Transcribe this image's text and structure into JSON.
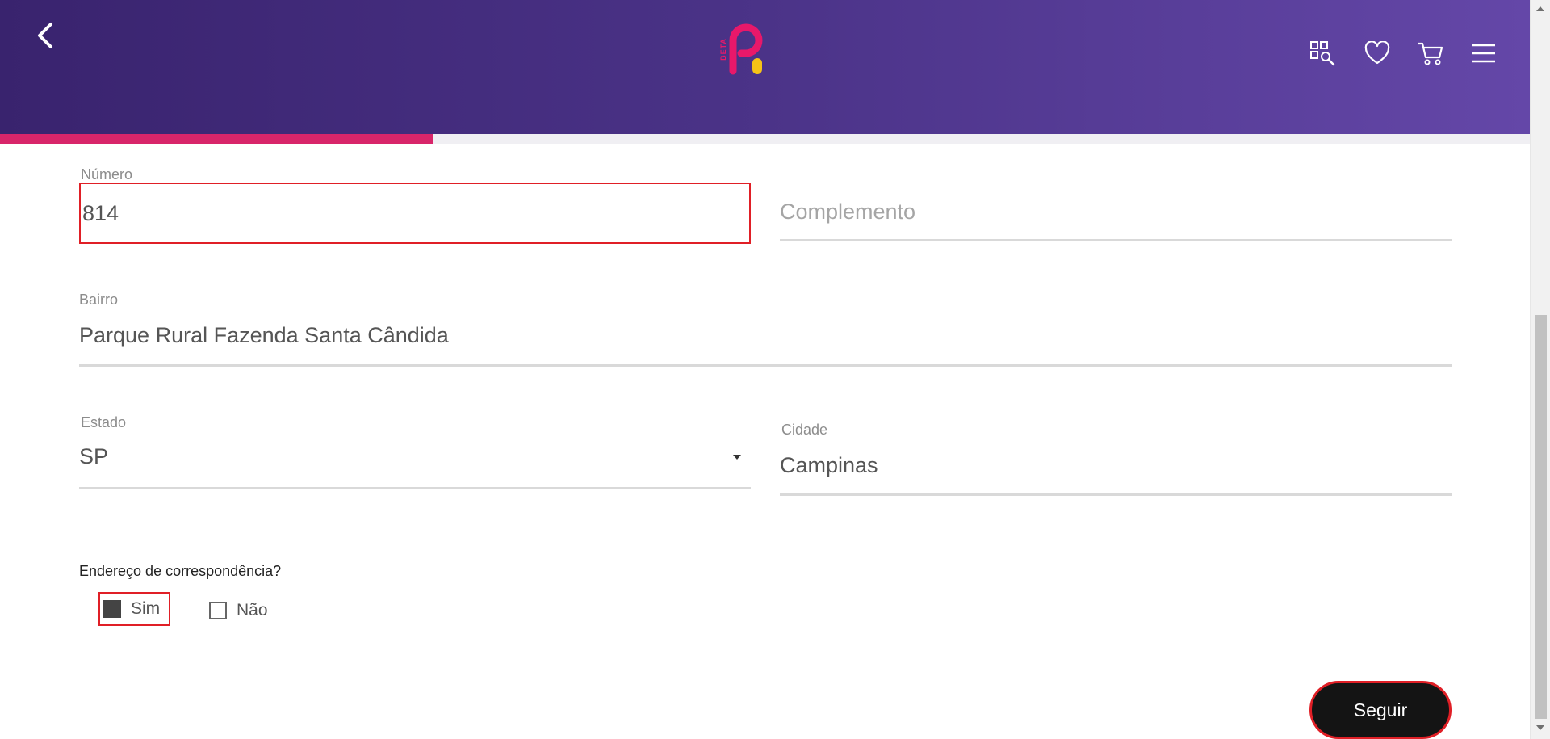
{
  "header": {
    "logo_badge": "BETA",
    "progress_fraction": 0.283,
    "icons": [
      "back-icon",
      "catalog-search-icon",
      "heart-icon",
      "cart-icon",
      "menu-icon"
    ],
    "colors": {
      "gradient_start": "#39236e",
      "gradient_end": "#6447a8",
      "progress": "#d8256a",
      "logo_pink": "#e8186a",
      "logo_yellow": "#f6c317"
    }
  },
  "form": {
    "numero": {
      "label": "Número",
      "value": "814"
    },
    "complemento": {
      "placeholder": "Complemento",
      "value": ""
    },
    "bairro": {
      "label": "Bairro",
      "value": "Parque Rural Fazenda Santa Cândida"
    },
    "estado": {
      "label": "Estado",
      "value": "SP"
    },
    "cidade": {
      "label": "Cidade",
      "value": "Campinas"
    },
    "correspondencia": {
      "question": "Endereço de correspondência?",
      "options": [
        {
          "label": "Sim",
          "checked": true
        },
        {
          "label": "Não",
          "checked": false
        }
      ]
    },
    "submit_label": "Seguir"
  },
  "colors": {
    "highlight": "#e01f26",
    "button_bg": "#141414"
  }
}
